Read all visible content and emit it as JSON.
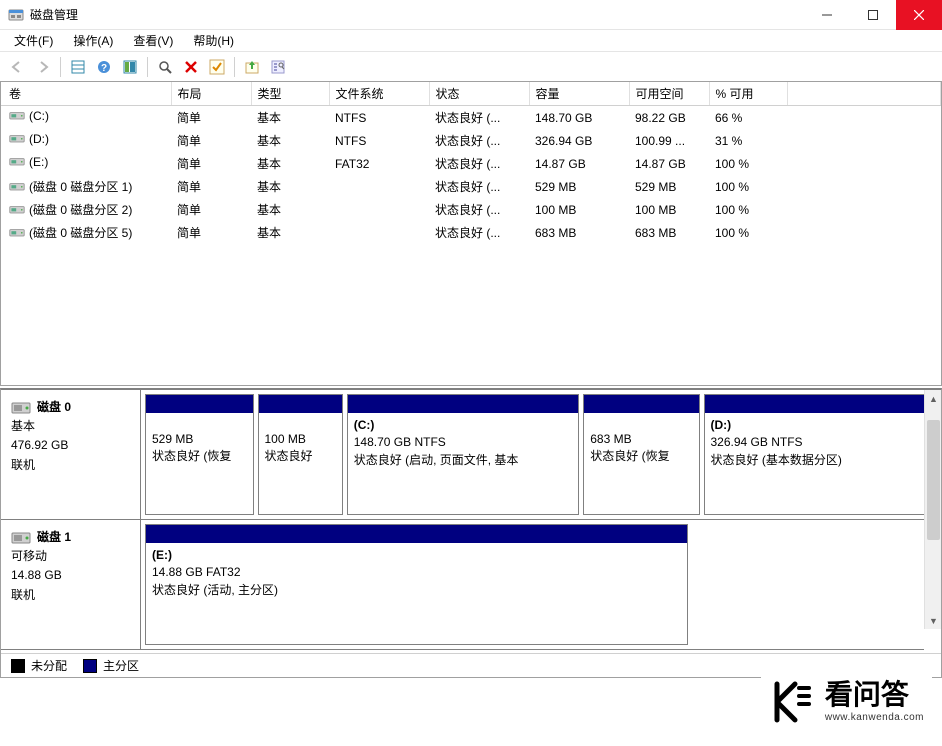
{
  "window": {
    "title": "磁盘管理"
  },
  "menubar": [
    "文件(F)",
    "操作(A)",
    "查看(V)",
    "帮助(H)"
  ],
  "table": {
    "headers": [
      "卷",
      "布局",
      "类型",
      "文件系统",
      "状态",
      "容量",
      "可用空间",
      "% 可用"
    ],
    "rows": [
      {
        "vol": "(C:)",
        "layout": "简单",
        "type": "基本",
        "fs": "NTFS",
        "status": "状态良好 (...",
        "cap": "148.70 GB",
        "free": "98.22 GB",
        "pct": "66 %"
      },
      {
        "vol": "(D:)",
        "layout": "简单",
        "type": "基本",
        "fs": "NTFS",
        "status": "状态良好 (...",
        "cap": "326.94 GB",
        "free": "100.99 ...",
        "pct": "31 %"
      },
      {
        "vol": "(E:)",
        "layout": "简单",
        "type": "基本",
        "fs": "FAT32",
        "status": "状态良好 (...",
        "cap": "14.87 GB",
        "free": "14.87 GB",
        "pct": "100 %"
      },
      {
        "vol": "(磁盘 0 磁盘分区 1)",
        "layout": "简单",
        "type": "基本",
        "fs": "",
        "status": "状态良好 (...",
        "cap": "529 MB",
        "free": "529 MB",
        "pct": "100 %"
      },
      {
        "vol": "(磁盘 0 磁盘分区 2)",
        "layout": "简单",
        "type": "基本",
        "fs": "",
        "status": "状态良好 (...",
        "cap": "100 MB",
        "free": "100 MB",
        "pct": "100 %"
      },
      {
        "vol": "(磁盘 0 磁盘分区 5)",
        "layout": "简单",
        "type": "基本",
        "fs": "",
        "status": "状态良好 (...",
        "cap": "683 MB",
        "free": "683 MB",
        "pct": "100 %"
      }
    ]
  },
  "disks": [
    {
      "name": "磁盘 0",
      "type": "基本",
      "size": "476.92 GB",
      "status": "联机",
      "partitions": [
        {
          "title": "",
          "line2": "529 MB",
          "line3": "状态良好 (恢复",
          "flex": 14
        },
        {
          "title": "",
          "line2": "100 MB",
          "line3": "状态良好",
          "flex": 11
        },
        {
          "title": "(C:)",
          "line2": "148.70 GB NTFS",
          "line3": "状态良好 (启动, 页面文件, 基本",
          "flex": 30
        },
        {
          "title": "",
          "line2": "683 MB",
          "line3": "状态良好 (恢复",
          "flex": 15
        },
        {
          "title": "(D:)",
          "line2": "326.94 GB NTFS",
          "line3": "状态良好 (基本数据分区)",
          "flex": 30
        }
      ]
    },
    {
      "name": "磁盘 1",
      "type": "可移动",
      "size": "14.88 GB",
      "status": "联机",
      "partitions": [
        {
          "title": "(E:)",
          "line2": "14.88 GB FAT32",
          "line3": "状态良好 (活动, 主分区)",
          "flex": 70
        }
      ]
    }
  ],
  "legend": {
    "unallocated": "未分配",
    "primary": "主分区"
  },
  "watermark": {
    "line1": "看问答",
    "line2": "www.kanwenda.com"
  }
}
